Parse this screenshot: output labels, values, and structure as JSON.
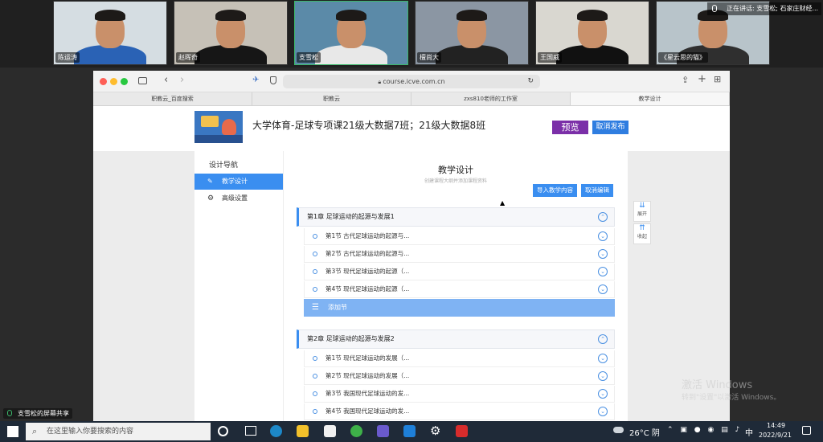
{
  "video": {
    "participants": [
      {
        "name": "陈运涛",
        "tone": "#d5dde2",
        "shirt": "#2a62b5"
      },
      {
        "name": "赵晖奇",
        "tone": "#c6c1b7",
        "shirt": "#161616"
      },
      {
        "name": "支雪松",
        "tone": "#5b8aa8",
        "shirt": "#e8e8e8"
      },
      {
        "name": "檀尚大",
        "tone": "#8b96a3",
        "shirt": "#222"
      },
      {
        "name": "王国威",
        "tone": "#d9d7d0",
        "shirt": "#111"
      },
      {
        "name": "《星云思的猫》",
        "tone": "#b8c4ca",
        "shirt": "#2f2f2f"
      }
    ],
    "speaking": "正在讲话: 支雪松; 石家庄财经..."
  },
  "browser": {
    "url": "course.icve.com.cn",
    "tabs": [
      "职教云_百度搜索",
      "职教云",
      "zxs810老师的工作室",
      "教学设计"
    ]
  },
  "course": {
    "title": "大学体育-足球专项课21级大数据7班；21级大数据8班",
    "preview": "预览",
    "cancel_publish": "取消发布"
  },
  "sidebar": {
    "title": "设计导航",
    "items": [
      "教学设计",
      "高级设置"
    ]
  },
  "main": {
    "title": "教学设计",
    "subtitle": "创建课程大纲并添加课程资料",
    "import_btn": "导入教学内容",
    "cancel_edit_btn": "取消编辑",
    "add_section": "添加节",
    "chapters": [
      {
        "label": "第1章    足球运动的起源与发展1",
        "sections": [
          "第1节    古代足球运动的起源与...",
          "第2节    古代足球运动的起源与...",
          "第3节    现代足球运动的起源（...",
          "第4节    现代足球运动的起源（..."
        ]
      },
      {
        "label": "第2章    足球运动的起源与发展2",
        "sections": [
          "第1节    现代足球运动的发展（...",
          "第2节    现代足球运动的发展（...",
          "第3节    我国现代足球运动的发...",
          "第4节    我国现代足球运动的发..."
        ]
      }
    ]
  },
  "floating": {
    "expand": "展开",
    "collapse": "收起"
  },
  "share_label": "支雪松的屏幕共享",
  "watermark": {
    "line1": "激活 Windows",
    "line2": "转到\"设置\"以激活 Windows。"
  },
  "taskbar": {
    "search_placeholder": "在这里输入你要搜索的内容",
    "weather": "26°C 阴",
    "ime": "中",
    "time": "14:49",
    "date": "2022/9/21"
  },
  "colors": {
    "accent": "#3a8ef0",
    "preview": "#7b2fa8",
    "publish": "#2f7de0"
  }
}
